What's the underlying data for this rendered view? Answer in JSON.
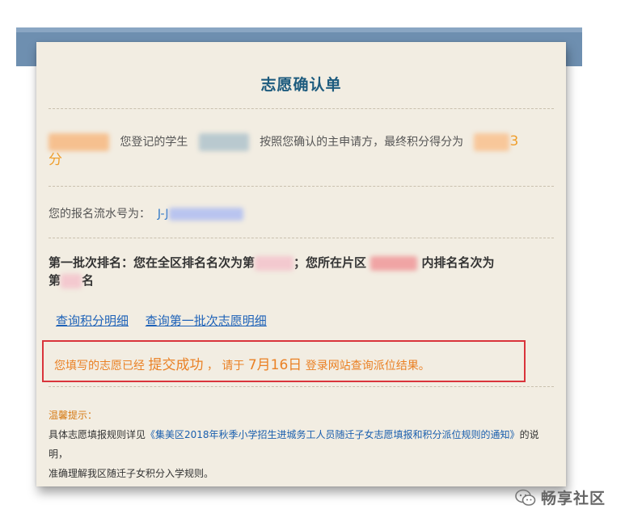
{
  "page": {
    "title": "志愿确认单",
    "intro": {
      "part1": "您登记的学生",
      "part2": "按照您确认的主申请方，最终积分得分为",
      "score_tail": "3",
      "unit": "分"
    },
    "serial": {
      "label": "您的报名流水号为：",
      "value_prefix": "J-J"
    },
    "ranking": {
      "part1": "第一批次排名：您在全区排名名次为第",
      "part2": "；您所在片区",
      "part3": "内排名名次为",
      "line2_prefix": "第",
      "line2_suffix": "名"
    },
    "links": {
      "points_detail": "查询积分明细",
      "first_batch_detail": "查询第一批次志愿明细"
    },
    "notice": {
      "part1": "您填写的志愿已经",
      "status": "提交成功",
      "comma": "，",
      "please": "请于",
      "date": "7月16日",
      "part2": "登录网站查询派位结果。"
    },
    "tips": {
      "title": "温馨提示：",
      "prefix": "具体志愿填报规则详见",
      "doc": "《集美区2018年秋季小学招生进城务工人员随迁子女志愿填报和积分派位规则的通知》",
      "suffix": "的说明，",
      "line2": "准确理解我区随迁子女积分入学规则。"
    }
  },
  "watermark": {
    "icon": "wechat-icon",
    "text": "畅享社区"
  },
  "colors": {
    "title": "#1d5b7e",
    "orange": "#ef9d2a",
    "link": "#1e62b8",
    "notice_border": "#d9343b",
    "card_bg": "#f2ede2",
    "topbar": "#6e8fb0"
  }
}
